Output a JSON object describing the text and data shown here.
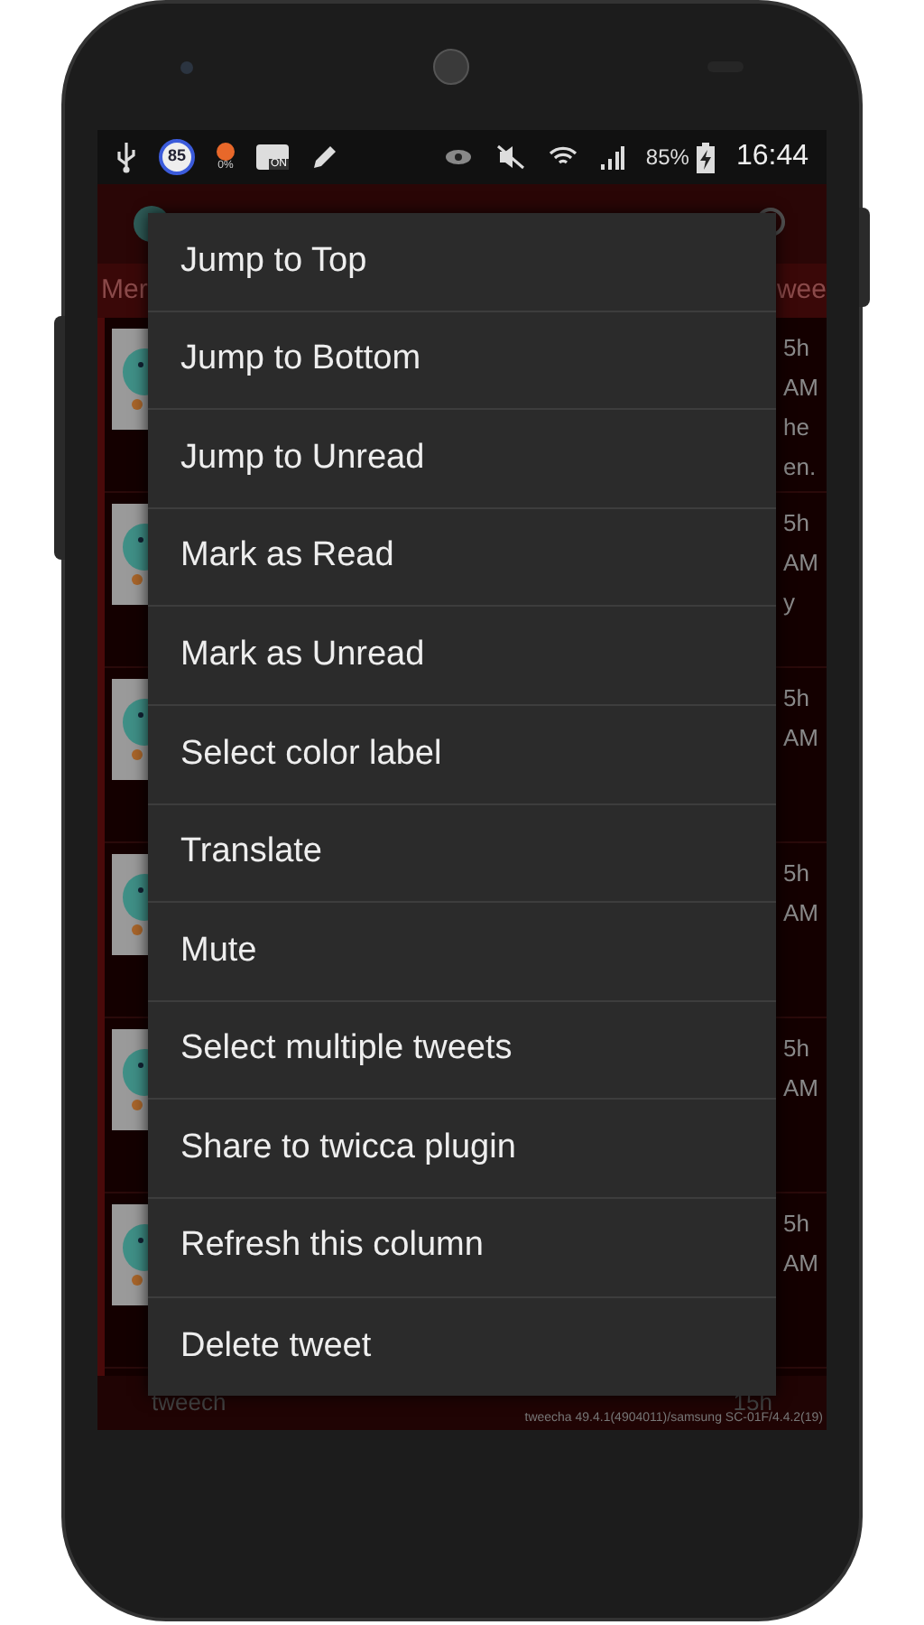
{
  "status_bar": {
    "notifications": [
      {
        "kind": "usb"
      },
      {
        "kind": "badge",
        "text": "85"
      },
      {
        "kind": "meter",
        "text": "0%"
      },
      {
        "kind": "voicemail",
        "text": "ON"
      },
      {
        "kind": "pencil"
      }
    ],
    "battery": "85%",
    "time": "16:44"
  },
  "background": {
    "tab_left": "Mer",
    "tab_right": "wee",
    "rows": [
      {
        "texts": [
          "5h",
          "AM",
          "he",
          "en."
        ]
      },
      {
        "texts": [
          "5h",
          "AM",
          "y"
        ]
      },
      {
        "texts": [
          "5h",
          "AM"
        ]
      },
      {
        "texts": [
          "5h",
          "AM"
        ]
      },
      {
        "texts": [
          "5h",
          "AM"
        ]
      },
      {
        "texts": [
          "5h",
          "AM"
        ]
      }
    ],
    "footer_left": "tweech",
    "footer_right": "15h",
    "version": "tweecha 49.4.1(4904011)/samsung SC-01F/4.4.2(19)"
  },
  "menu": {
    "items": [
      "Jump to Top",
      "Jump to Bottom",
      "Jump to Unread",
      "Mark as Read",
      "Mark as Unread",
      "Select color label",
      "Translate",
      "Mute",
      "Select multiple tweets",
      "Share to twicca plugin",
      "Refresh this column",
      "Delete tweet"
    ]
  }
}
